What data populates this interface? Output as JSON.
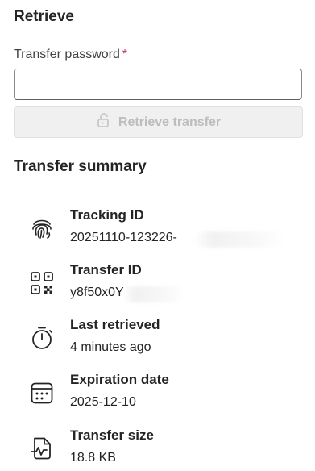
{
  "retrieve": {
    "title": "Retrieve",
    "password_label": "Transfer password",
    "required_marker": "*",
    "password_value": "",
    "button_label": "Retrieve transfer"
  },
  "summary": {
    "title": "Transfer summary",
    "items": [
      {
        "label": "Tracking ID",
        "value": "20251110-123226-",
        "icon": "fingerprint-icon"
      },
      {
        "label": "Transfer ID",
        "value": "y8f50x0Y",
        "icon": "qr-code-icon"
      },
      {
        "label": "Last retrieved",
        "value": "4 minutes ago",
        "icon": "timer-icon"
      },
      {
        "label": "Expiration date",
        "value": "2025-12-10",
        "icon": "calendar-icon"
      },
      {
        "label": "Transfer size",
        "value": "18.8 KB",
        "icon": "document-pulse-icon"
      }
    ]
  },
  "colors": {
    "required": "#c4314b",
    "disabled_text": "#bdbdbd",
    "disabled_bg": "#f0f0f0"
  }
}
